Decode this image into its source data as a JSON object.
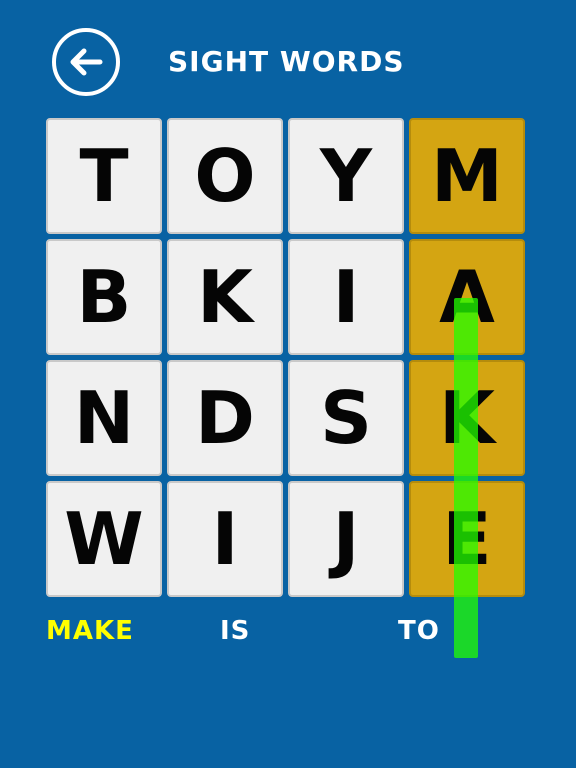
{
  "header": {
    "title": "SIGHT WORDS",
    "back_icon": "arrow-left-icon"
  },
  "grid": {
    "rows": [
      [
        "T",
        "O",
        "Y",
        "M"
      ],
      [
        "B",
        "K",
        "I",
        "A"
      ],
      [
        "N",
        "D",
        "S",
        "K"
      ],
      [
        "W",
        "I",
        "J",
        "E"
      ]
    ],
    "found_column": 3
  },
  "words": [
    {
      "text": "MAKE",
      "found": true
    },
    {
      "text": "IS",
      "found": false
    },
    {
      "text": "TO",
      "found": false
    }
  ],
  "colors": {
    "background": "#0862a3",
    "tile": "#f0f0f0",
    "found_tile": "#d4a512",
    "selection_line": "#22ff00",
    "found_word": "#ffff00",
    "word": "#ffffff"
  }
}
